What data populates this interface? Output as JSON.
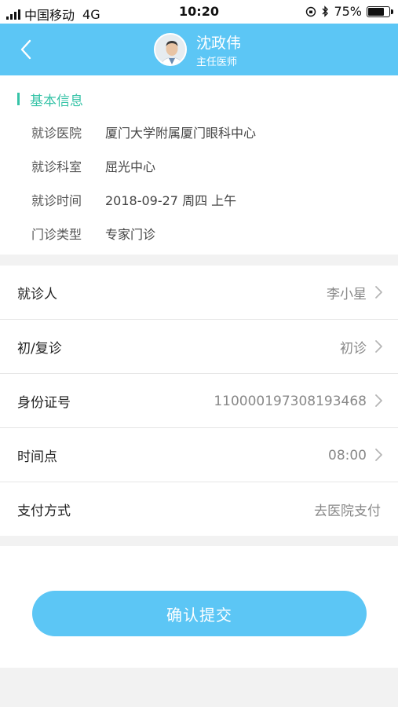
{
  "status_bar": {
    "carrier": "中国移动",
    "network": "4G",
    "time": "10:20",
    "battery_text": "75%",
    "battery_level": 0.75
  },
  "nav": {
    "doctor_name": "沈政伟",
    "doctor_title": "主任医师",
    "bg_color": "#5cc6f5"
  },
  "basic_info": {
    "section_title": "基本信息",
    "rows": [
      {
        "label": "就诊医院",
        "value": "厦门大学附属厦门眼科中心"
      },
      {
        "label": "就诊科室",
        "value": "屈光中心"
      },
      {
        "label": "就诊时间",
        "value": "2018-09-27 周四 上午"
      },
      {
        "label": "门诊类型",
        "value": "专家门诊"
      }
    ]
  },
  "form": {
    "rows": [
      {
        "label": "就诊人",
        "value": "李小星"
      },
      {
        "label": "初/复诊",
        "value": "初诊"
      },
      {
        "label": "身份证号",
        "value": "110000197308193468"
      },
      {
        "label": "时间点",
        "value": "08:00"
      },
      {
        "label": "支付方式",
        "value": "去医院支付"
      }
    ]
  },
  "submit": {
    "label": "确认提交"
  }
}
